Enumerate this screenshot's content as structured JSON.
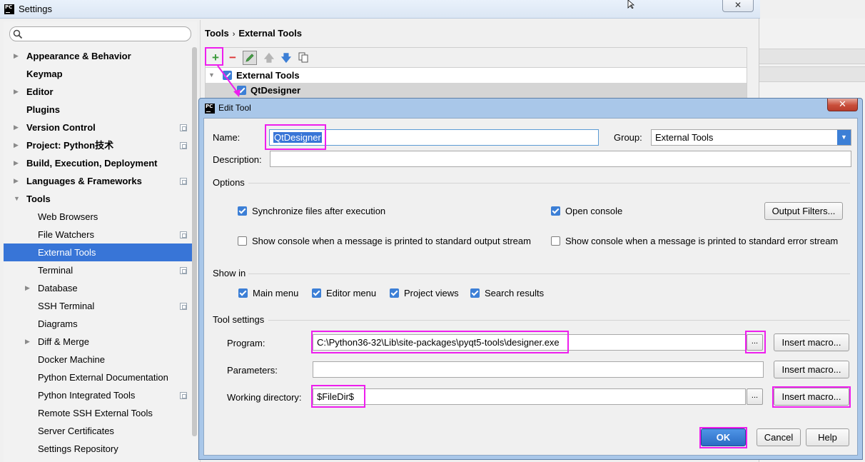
{
  "settings": {
    "title": "Settings",
    "search": {
      "placeholder": ""
    },
    "tree": [
      {
        "label": "Appearance & Behavior",
        "level": 0,
        "bold": true,
        "arrow": "▶",
        "project": false
      },
      {
        "label": "Keymap",
        "level": 0,
        "bold": true,
        "arrow": "",
        "project": false
      },
      {
        "label": "Editor",
        "level": 0,
        "bold": true,
        "arrow": "▶",
        "project": false
      },
      {
        "label": "Plugins",
        "level": 0,
        "bold": true,
        "arrow": "",
        "project": false
      },
      {
        "label": "Version Control",
        "level": 0,
        "bold": true,
        "arrow": "▶",
        "project": true
      },
      {
        "label": "Project: Python技术",
        "level": 0,
        "bold": true,
        "arrow": "▶",
        "project": true
      },
      {
        "label": "Build, Execution, Deployment",
        "level": 0,
        "bold": true,
        "arrow": "▶",
        "project": false
      },
      {
        "label": "Languages & Frameworks",
        "level": 0,
        "bold": true,
        "arrow": "▶",
        "project": true
      },
      {
        "label": "Tools",
        "level": 0,
        "bold": true,
        "arrow": "▼",
        "project": false
      },
      {
        "label": "Web Browsers",
        "level": 1,
        "bold": false,
        "arrow": "",
        "project": false
      },
      {
        "label": "File Watchers",
        "level": 1,
        "bold": false,
        "arrow": "",
        "project": true
      },
      {
        "label": "External Tools",
        "level": 1,
        "bold": false,
        "arrow": "",
        "project": false,
        "selected": true
      },
      {
        "label": "Terminal",
        "level": 1,
        "bold": false,
        "arrow": "",
        "project": true
      },
      {
        "label": "Database",
        "level": 1,
        "bold": false,
        "arrow": "▶",
        "project": false
      },
      {
        "label": "SSH Terminal",
        "level": 1,
        "bold": false,
        "arrow": "",
        "project": true
      },
      {
        "label": "Diagrams",
        "level": 1,
        "bold": false,
        "arrow": "",
        "project": false
      },
      {
        "label": "Diff & Merge",
        "level": 1,
        "bold": false,
        "arrow": "▶",
        "project": false
      },
      {
        "label": "Docker Machine",
        "level": 1,
        "bold": false,
        "arrow": "",
        "project": false
      },
      {
        "label": "Python External Documentation",
        "level": 1,
        "bold": false,
        "arrow": "",
        "project": false
      },
      {
        "label": "Python Integrated Tools",
        "level": 1,
        "bold": false,
        "arrow": "",
        "project": true
      },
      {
        "label": "Remote SSH External Tools",
        "level": 1,
        "bold": false,
        "arrow": "",
        "project": false
      },
      {
        "label": "Server Certificates",
        "level": 1,
        "bold": false,
        "arrow": "",
        "project": false
      },
      {
        "label": "Settings Repository",
        "level": 1,
        "bold": false,
        "arrow": "",
        "project": false
      }
    ],
    "breadcrumb": {
      "parent": "Tools",
      "separator": "›",
      "current": "External Tools"
    },
    "tools_tree": {
      "group": "External Tools",
      "item": "QtDesigner"
    }
  },
  "edit_tool": {
    "title": "Edit Tool",
    "name_label": "Name:",
    "name_value": "QtDesigner",
    "group_label": "Group:",
    "group_value": "External Tools",
    "description_label": "Description:",
    "description_value": "",
    "options_header": "Options",
    "sync_files": {
      "label": "Synchronize files after execution",
      "checked": true
    },
    "open_console": {
      "label": "Open console",
      "checked": true
    },
    "output_filters_button": "Output Filters...",
    "show_console_stdout": {
      "label": "Show console when a message is printed to standard output stream",
      "checked": false
    },
    "show_console_stderr": {
      "label": "Show console when a message is printed to standard error stream",
      "checked": false
    },
    "show_in_header": "Show in",
    "show_in": [
      {
        "label": "Main menu",
        "checked": true
      },
      {
        "label": "Editor menu",
        "checked": true
      },
      {
        "label": "Project views",
        "checked": true
      },
      {
        "label": "Search results",
        "checked": true
      }
    ],
    "tool_settings_header": "Tool settings",
    "program_label": "Program:",
    "program_value": "C:\\Python36-32\\Lib\\site-packages\\pyqt5-tools\\designer.exe",
    "browse_label": "...",
    "parameters_label": "Parameters:",
    "parameters_value": "",
    "working_dir_label": "Working directory:",
    "working_dir_value": "$FileDir$",
    "insert_macro_label": "Insert macro...",
    "ok_label": "OK",
    "cancel_label": "Cancel",
    "help_label": "Help"
  },
  "colors": {
    "accent": "#3875d7",
    "highlight": "#ee1eee",
    "dialog_frame": "#a9c7e9"
  }
}
